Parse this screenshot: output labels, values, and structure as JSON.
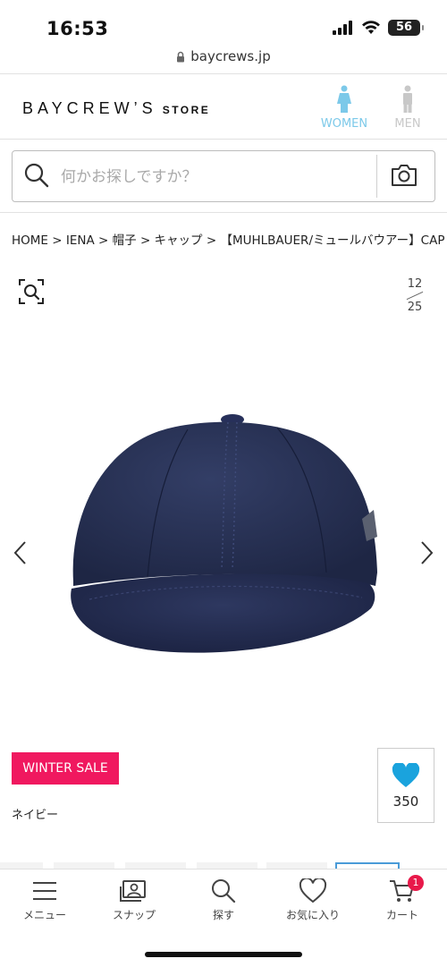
{
  "status_bar": {
    "time": "16:53",
    "battery": "56"
  },
  "browser": {
    "url": "baycrews.jp"
  },
  "header": {
    "logo_main": "BAYCREW’S",
    "logo_sub": "STORE",
    "gender_women": "WOMEN",
    "gender_men": "MEN",
    "colors": {
      "women_active": "#7cc9e9",
      "men_inactive": "#c8c8c8"
    }
  },
  "search": {
    "placeholder": "何かお探しですか？"
  },
  "breadcrumb": {
    "items": [
      "HOME",
      "IENA",
      "帽子",
      "キャップ",
      "【MUHLBAUER/ミュールバウアー】CAP B"
    ],
    "separator": ">"
  },
  "gallery": {
    "current": "12",
    "total": "25"
  },
  "product": {
    "sale_badge": "WINTER SALE",
    "color_name": "ネイビー",
    "favorite_count": "350",
    "colors": {
      "sale": "#f0185f",
      "heart": "#1aa3dd",
      "cap": "#283357"
    }
  },
  "tab_bar": {
    "items": [
      {
        "label": "メニュー",
        "icon": "menu-icon"
      },
      {
        "label": "スナップ",
        "icon": "snap-icon"
      },
      {
        "label": "探す",
        "icon": "search-icon"
      },
      {
        "label": "お気に入り",
        "icon": "heart-icon"
      },
      {
        "label": "カート",
        "icon": "cart-icon"
      }
    ],
    "cart_count": "1"
  }
}
